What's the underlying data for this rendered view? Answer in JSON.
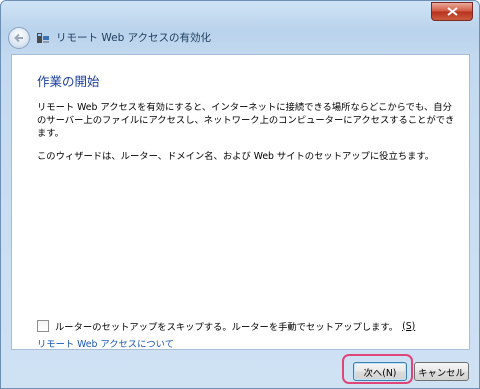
{
  "window": {
    "title": "リモート Web アクセスの有効化"
  },
  "page": {
    "heading": "作業の開始",
    "paragraph1": "リモート Web アクセスを有効にすると、インターネットに接続できる場所ならどこからでも、自分のサーバー上のファイルにアクセスし、ネットワーク上のコンピューターにアクセスすることができます。",
    "paragraph2": "このウィザードは、ルーター、ドメイン名、および Web サイトのセットアップに役立ちます。",
    "skip_checkbox": {
      "label": "ルーターのセットアップをスキップする。ルーターを手動でセットアップします。",
      "accesskey": "(S)",
      "checked": false
    },
    "about_link": "リモート Web アクセスについて"
  },
  "footer": {
    "next_label": "次へ(N)",
    "cancel_label": "キャンセル"
  },
  "colors": {
    "heading": "#1b3d9e",
    "link": "#1a56b3",
    "highlight": "#e0457a"
  },
  "icons": [
    "close-icon",
    "back-arrow-icon",
    "remote-access-icon"
  ]
}
